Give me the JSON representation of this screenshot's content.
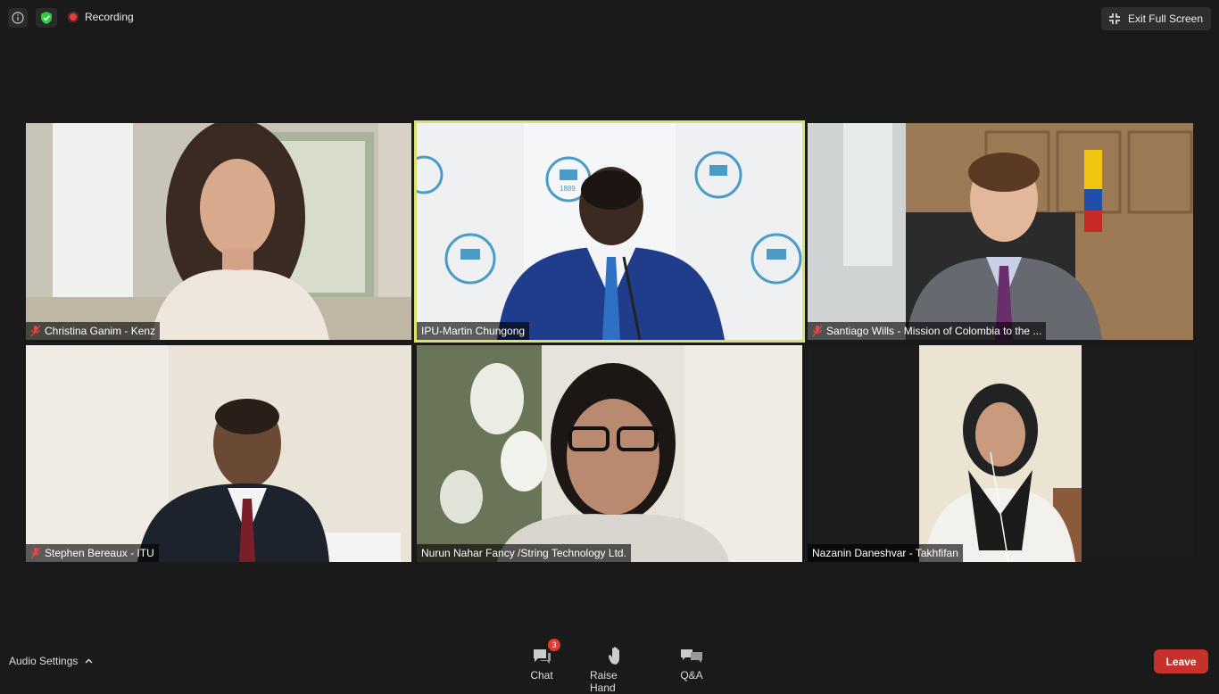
{
  "topbar": {
    "recording_label": "Recording",
    "exit_fullscreen_label": "Exit Full Screen"
  },
  "participants": [
    {
      "name": "Christina Ganim - Kenz",
      "muted": true
    },
    {
      "name": "IPU-Martin Chungong",
      "muted": false,
      "active_speaker": true
    },
    {
      "name": "Santiago Wills - Mission of Colombia to the ...",
      "muted": true
    },
    {
      "name": "Stephen Bereaux - ITU",
      "muted": true
    },
    {
      "name": "Nurun Nahar Fancy /String Technology Ltd.",
      "muted": false
    },
    {
      "name": "Nazanin Daneshvar - Takhfifan",
      "muted": false
    }
  ],
  "video_text": {
    "ipu_year": "1889"
  },
  "toolbar": {
    "audio_settings_label": "Audio Settings",
    "chat_label": "Chat",
    "chat_badge": "3",
    "raise_hand_label": "Raise Hand",
    "qa_label": "Q&A",
    "leave_label": "Leave"
  },
  "colors": {
    "active_speaker_border": "#d7e36b",
    "leave_button": "#c6312b",
    "recording_dot": "#e0403a",
    "secure_shield": "#2ecc40"
  }
}
